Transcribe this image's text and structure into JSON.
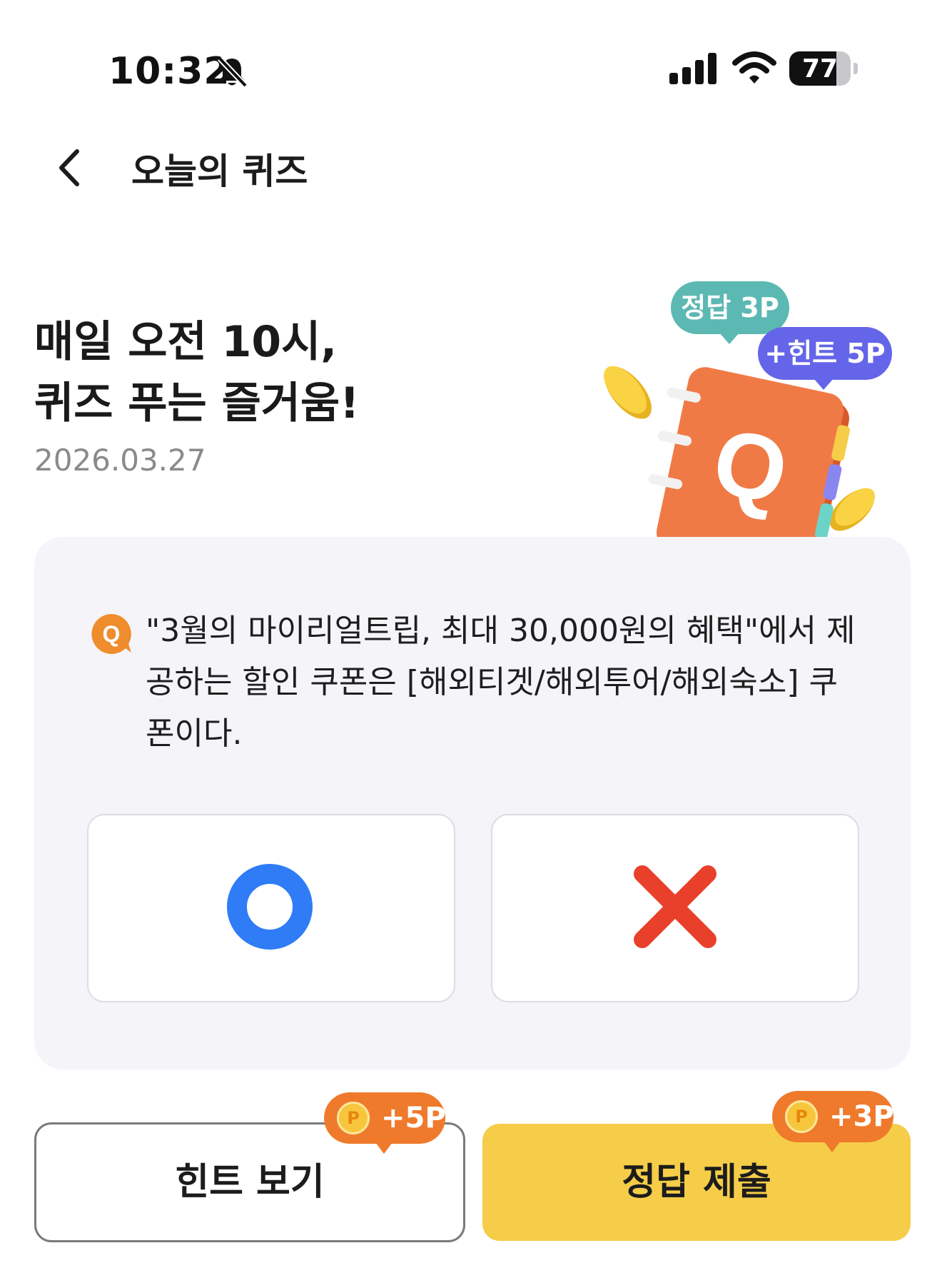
{
  "status_bar": {
    "time": "10:32",
    "battery": "77"
  },
  "header": {
    "title": "오늘의 퀴즈"
  },
  "hero": {
    "line1": "매일 오전 10시,",
    "line2": "퀴즈 푸는 즐거움!",
    "date": "2026.03.27"
  },
  "illustration": {
    "badge_answer": "정답 3P",
    "badge_hint": "+힌트 5P",
    "book_letter": "Q"
  },
  "quiz": {
    "badge": "Q",
    "question": "\"3월의 마이리얼트립, 최대 30,000원의 혜택\"에서 제공하는 할인 쿠폰은 [해외티겟/해외투어/해외숙소] 쿠폰이다.",
    "options": [
      "O",
      "X"
    ]
  },
  "buttons": {
    "hint_label": "힌트 보기",
    "hint_points": "+5P",
    "submit_label": "정답 제출",
    "submit_points": "+3P",
    "coin_letter": "P"
  },
  "colors": {
    "accent_yellow": "#f6cd48",
    "orange": "#ef7a2c",
    "o_blue": "#2f7cf6",
    "x_red": "#e8402a",
    "teal": "#5cb8b2",
    "purple": "#6465e8"
  }
}
